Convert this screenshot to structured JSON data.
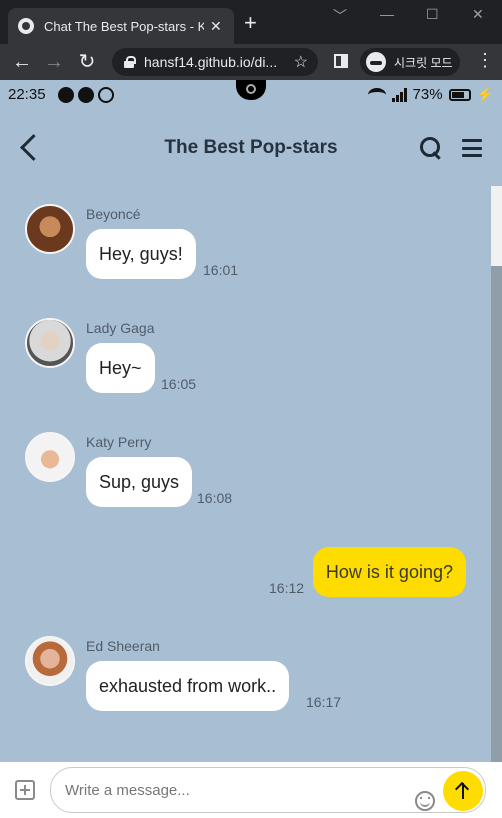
{
  "browser": {
    "tab_title": "Chat The Best Pop-stars - Ko",
    "tab_close": "✕",
    "new_tab": "+",
    "url": "hansf14.github.io/di...",
    "incognito_label": "시크릿 모드",
    "window_controls": [
      "﹀",
      "—",
      "☐",
      "✕"
    ]
  },
  "status_bar": {
    "time": "22:35",
    "battery": "73%",
    "icons": [
      "discord-icon",
      "chat-icon",
      "viber-icon",
      "wifi-icon",
      "signal-icon",
      "battery-icon",
      "charging-icon"
    ]
  },
  "header": {
    "title": "The Best Pop-stars"
  },
  "messages": [
    {
      "sender": "Beyoncé",
      "text": "Hey, guys!",
      "time": "16:01",
      "mine": false
    },
    {
      "sender": "Lady Gaga",
      "text": "Hey~",
      "time": "16:05",
      "mine": false
    },
    {
      "sender": "Katy Perry",
      "text": "Sup, guys",
      "time": "16:08",
      "mine": false
    },
    {
      "sender": "",
      "text": "How is it going?",
      "time": "16:12",
      "mine": true
    },
    {
      "sender": "Ed Sheeran",
      "text": "exhausted from work..",
      "time": "16:17",
      "mine": false
    }
  ],
  "composer": {
    "placeholder": "Write a message..."
  },
  "colors": {
    "chat_background": "#a8bed2",
    "my_bubble": "#fedc00",
    "other_bubble": "#ffffff",
    "send_button": "#fedc00"
  }
}
